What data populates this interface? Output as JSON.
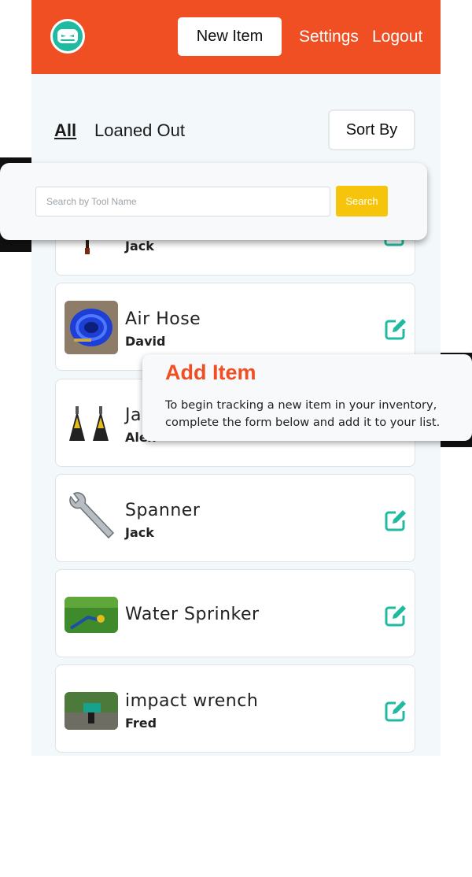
{
  "header": {
    "new_item_label": "New Item",
    "settings_label": "Settings",
    "logout_label": "Logout",
    "logo_icon": "mask-logo-icon",
    "brand_color": "#f04e23",
    "logo_color": "#1fbba0"
  },
  "filters": {
    "all_label": "All",
    "loaned_label": "Loaned Out",
    "sort_label": "Sort By"
  },
  "search": {
    "placeholder": "Search by Tool Name",
    "value": "",
    "button_label": "Search",
    "button_color": "#f6c40b"
  },
  "items": [
    {
      "name": "",
      "owner": "Jack",
      "image": "hammer-photo"
    },
    {
      "name": "Air Hose",
      "owner": "David",
      "image": "air-hose-photo"
    },
    {
      "name": "Jacks",
      "owner": "Alex",
      "image": "jack-stands-photo"
    },
    {
      "name": "Spanner",
      "owner": "Jack",
      "image": "spanner-photo"
    },
    {
      "name": "Water Sprinker",
      "owner": "",
      "image": "sprinkler-photo"
    },
    {
      "name": "impact wrench",
      "owner": "Fred",
      "image": "impact-wrench-photo"
    }
  ],
  "edit_icon": "edit-icon",
  "edit_color": "#1fbba0",
  "tooltip": {
    "title": "Add Item",
    "text": "To begin tracking a new item in your inventory, complete the form below and add it to your list."
  }
}
